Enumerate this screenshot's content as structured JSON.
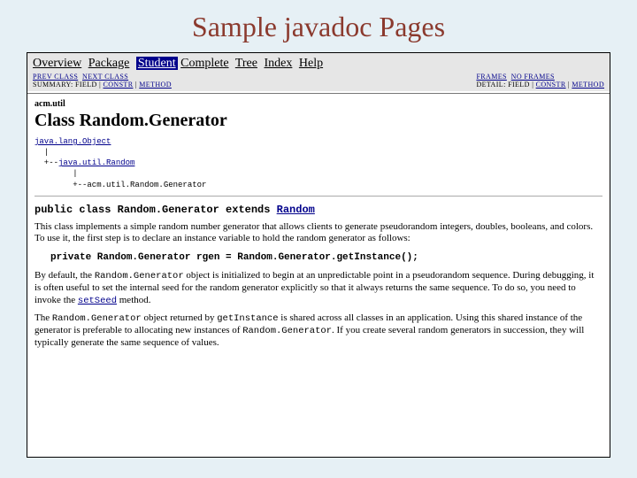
{
  "slide": {
    "title": "Sample javadoc Pages"
  },
  "nav": {
    "overview": "Overview",
    "package": "Package",
    "selected": "Student",
    "complete": "Complete",
    "tree": "Tree",
    "index": "Index",
    "help": "Help"
  },
  "subnav": {
    "left": {
      "prev": "PREV CLASS",
      "next": "NEXT CLASS",
      "summary_label": "SUMMARY: ",
      "summary_field": "FIELD",
      "summary_constr": "CONSTR",
      "summary_method": "METHOD"
    },
    "right": {
      "frames": "FRAMES",
      "noframes": "NO FRAMES",
      "detail_label": "DETAIL: ",
      "detail_field": "FIELD",
      "detail_constr": "CONSTR",
      "detail_method": "METHOD"
    }
  },
  "pkg": "acm.util",
  "class_title": "Class Random.Generator",
  "hierarchy": {
    "l1": "java.lang.Object",
    "l2": "  |",
    "l3a": "  +--",
    "l3b": "java.util.Random",
    "l4": "        |",
    "l5": "        +--acm.util.Random.Generator"
  },
  "decl": {
    "pre": "public class Random.Generator extends ",
    "link": "Random"
  },
  "para1": "This class implements a simple random number generator that allows clients to generate pseudorandom integers, doubles, booleans, and colors.  To use it, the first step is to declare an instance variable to hold the random generator as follows:",
  "code": "private Random.Generator rgen = Random.Generator.getInstance();",
  "para2a": "By default, the ",
  "para2b": "Random.Generator",
  "para2c": " object is initialized to begin at an unpredictable point in a pseudorandom sequence.  During debugging, it is often useful to set the internal seed for the random generator explicitly so that it always returns the same sequence.  To do so, you need to invoke the ",
  "para2d": "setSeed",
  "para2e": " method.",
  "para3a": "The ",
  "para3b": "Random.Generator",
  "para3c": " object returned by ",
  "para3d": "getInstance",
  "para3e": " is shared across all classes in an application.  Using this shared instance of the generator is preferable to allocating new instances of ",
  "para3f": "Random.Generator",
  "para3g": ". If you create several random generators in succession, they will typically generate the same sequence of values."
}
